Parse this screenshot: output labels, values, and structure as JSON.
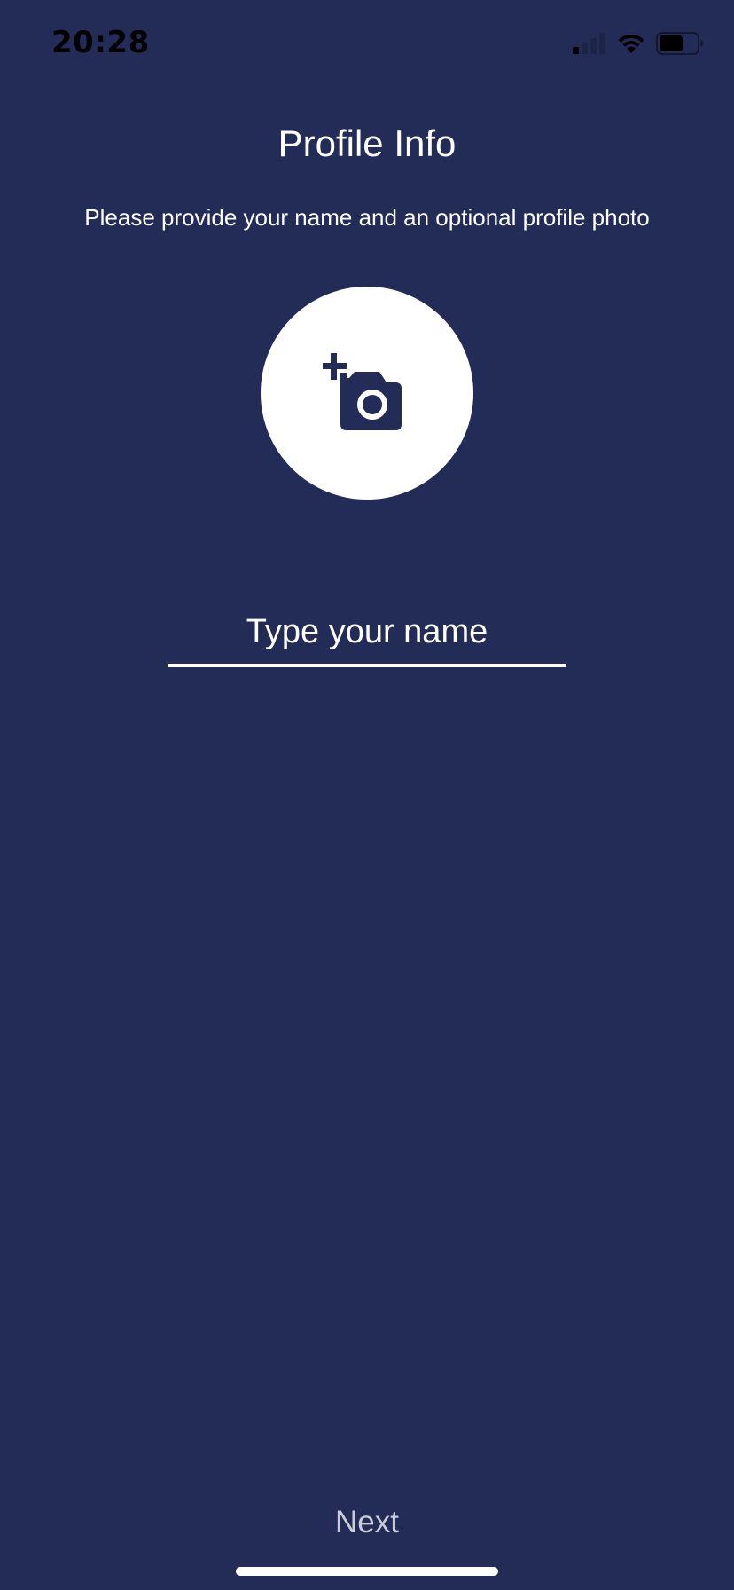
{
  "status_bar": {
    "time": "20:28",
    "icons": [
      "cellular-signal-icon",
      "wifi-icon",
      "battery-icon"
    ],
    "text_color": "#000000"
  },
  "screen": {
    "title": "Profile Info",
    "subtitle": "Please provide your name and an optional profile photo",
    "background_color": "#232b57"
  },
  "photo_button": {
    "icon": "add-photo-camera-icon",
    "background_color": "#ffffff"
  },
  "name_input": {
    "value": "",
    "placeholder": "Type your name"
  },
  "footer": {
    "next_label": "Next",
    "next_color": "#c9ccd9"
  }
}
